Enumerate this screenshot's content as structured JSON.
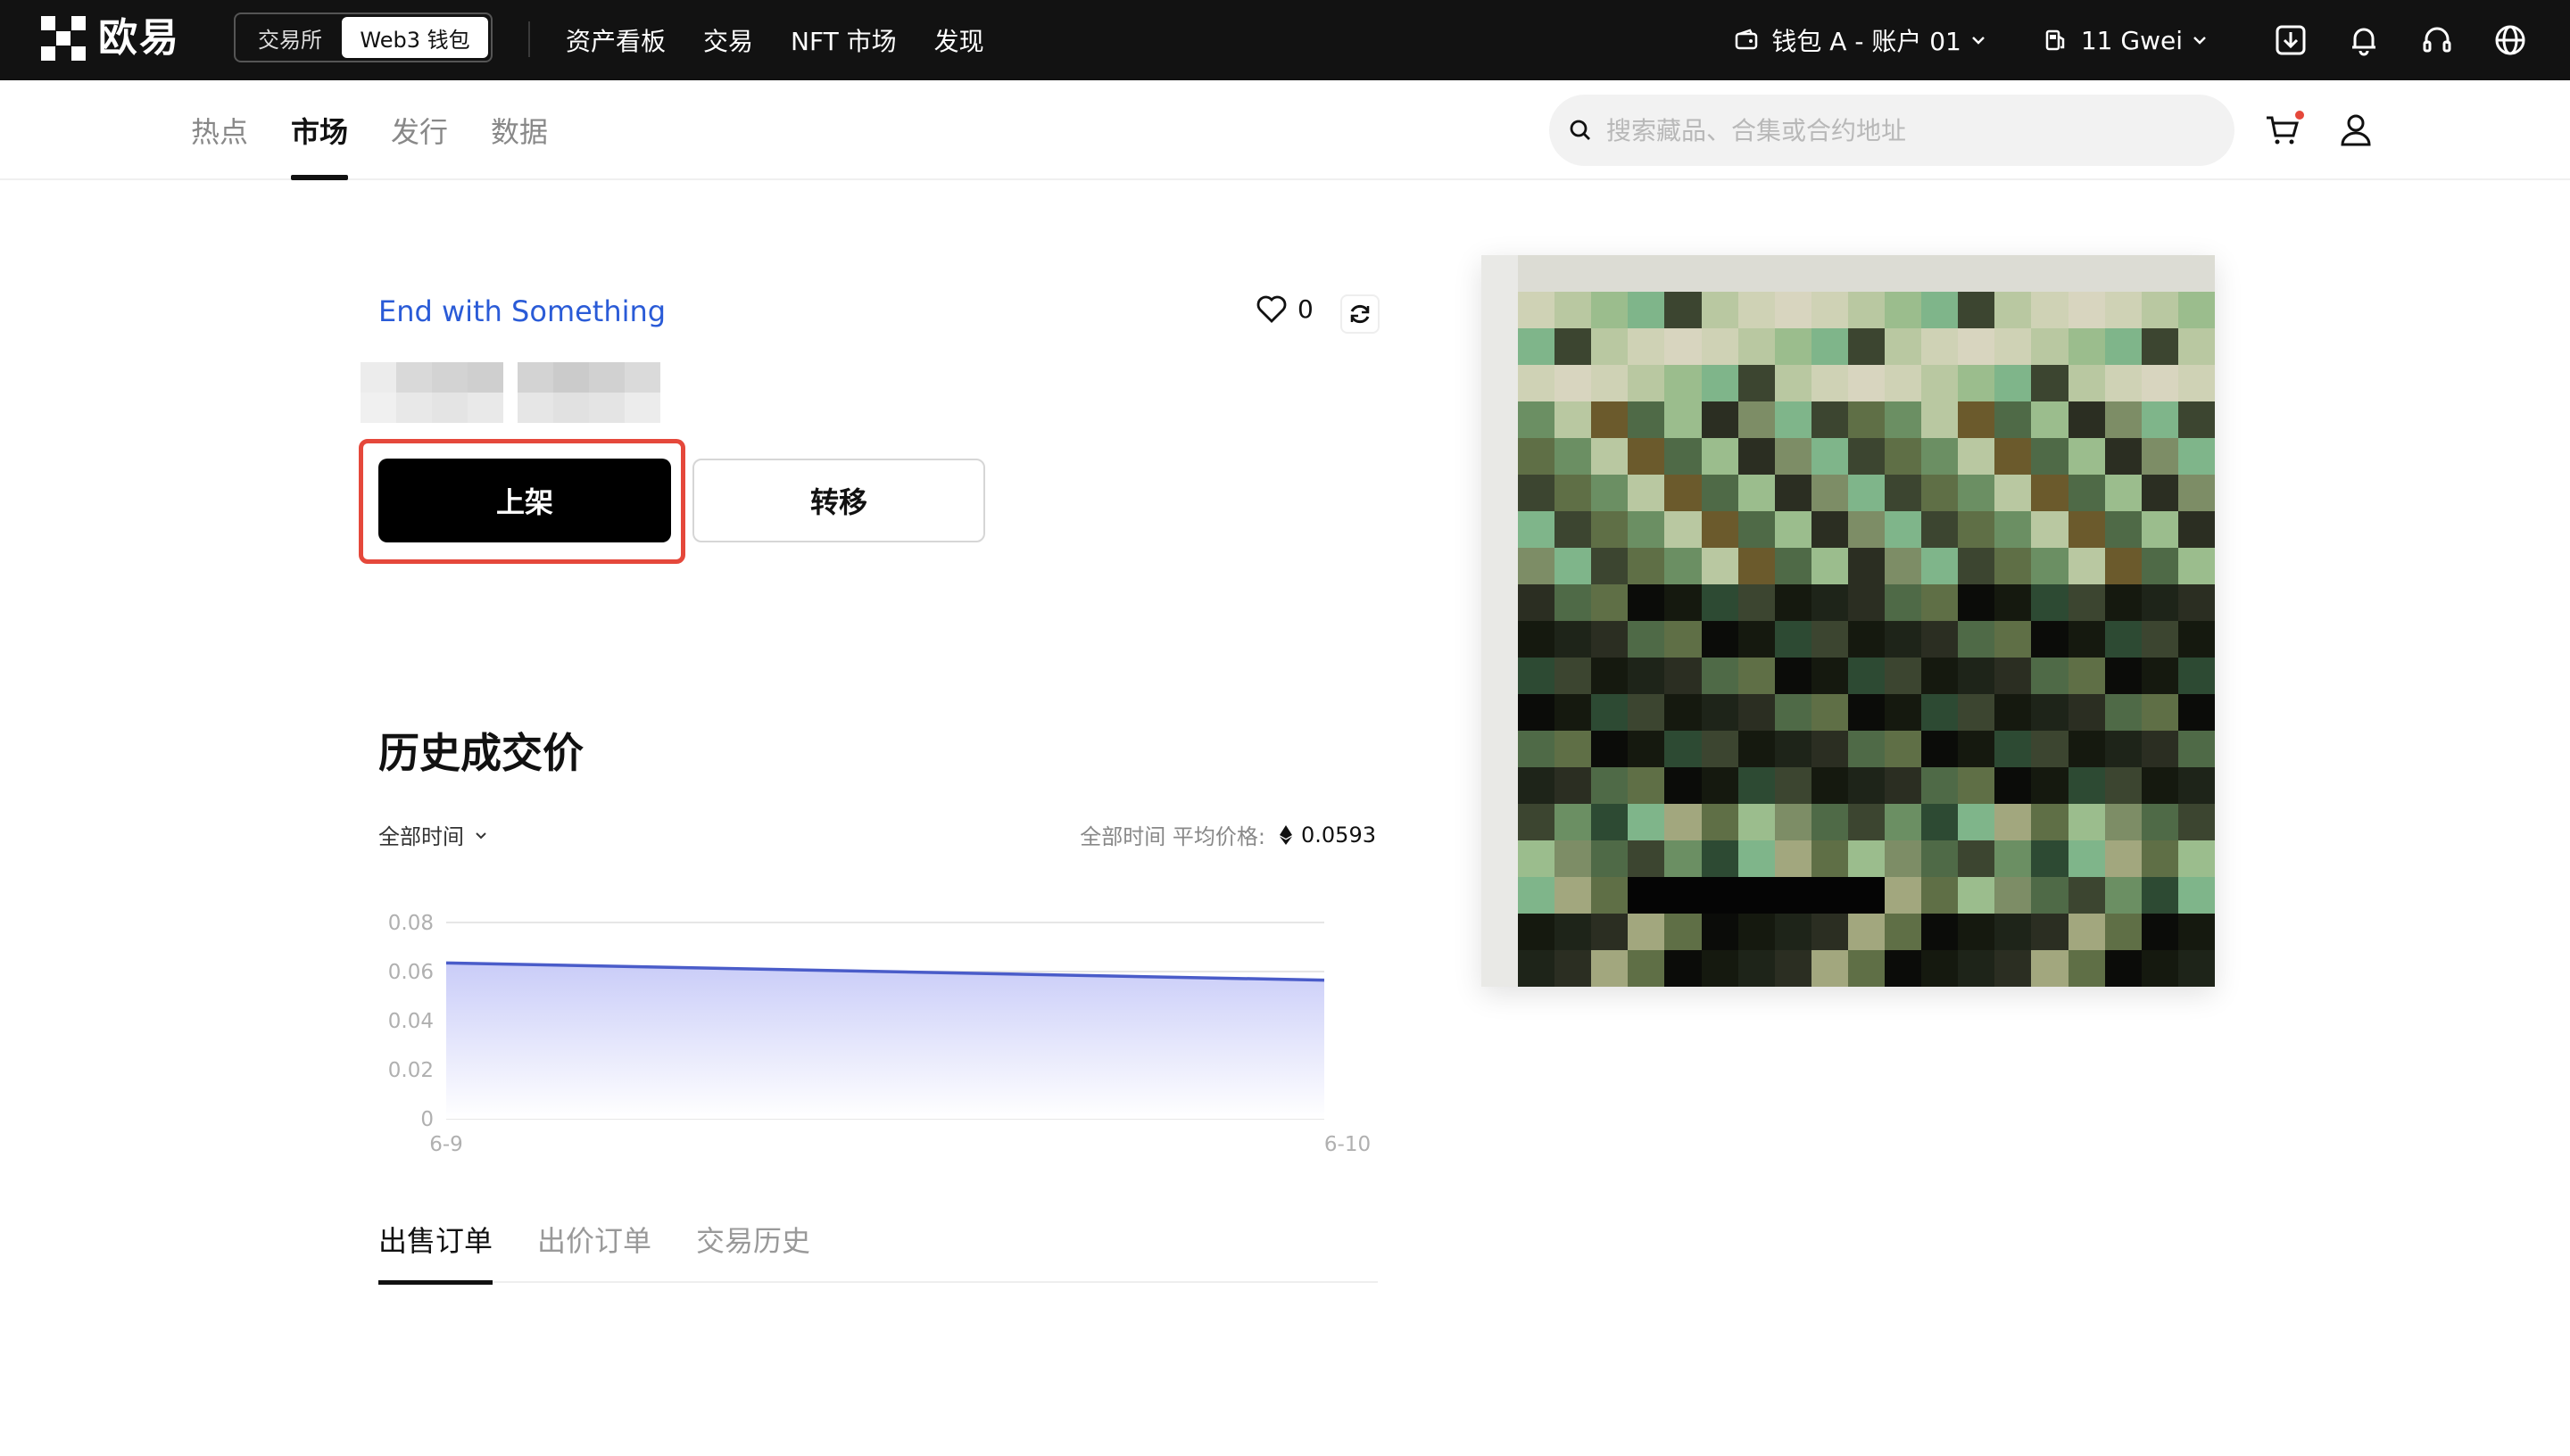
{
  "header": {
    "logo_text": "欧易",
    "mode_switch": {
      "exchange": "交易所",
      "web3": "Web3 钱包"
    },
    "nav": [
      "资产看板",
      "交易",
      "NFT 市场",
      "发现"
    ],
    "wallet_label": "钱包 A - 账户 01",
    "gas_label": "11 Gwei",
    "icons": [
      "download-icon",
      "bell-icon",
      "headset-icon",
      "globe-icon"
    ]
  },
  "subnav": {
    "tabs": [
      {
        "label": "热点",
        "active": false
      },
      {
        "label": "市场",
        "active": true
      },
      {
        "label": "发行",
        "active": false
      },
      {
        "label": "数据",
        "active": false
      }
    ],
    "search_placeholder": "搜索藏品、合集或合约地址"
  },
  "nft": {
    "collection": "End with Something",
    "likes": "0",
    "actions": {
      "list": "上架",
      "transfer": "转移"
    }
  },
  "history": {
    "title": "历史成交价",
    "range": "全部时间",
    "avg_label": "全部时间 平均价格:",
    "avg_value": "0.0593"
  },
  "chart_data": {
    "type": "area",
    "x": [
      "6-9",
      "6-10"
    ],
    "series": [
      {
        "values": [
          0.0635,
          0.0565
        ]
      }
    ],
    "yticks": [
      "0.08",
      "0.06",
      "0.04",
      "0.02",
      "0"
    ],
    "ylim": [
      0,
      0.08
    ],
    "grid": true,
    "color": "#4a5cc9"
  },
  "bottom_tabs": [
    {
      "label": "出售订单",
      "active": true
    },
    {
      "label": "出价订单",
      "active": false
    },
    {
      "label": "交易历史",
      "active": false
    }
  ],
  "colors": {
    "accent_link": "#2a5bd7",
    "highlight": "#e5483b",
    "topbar_bg": "#121212"
  }
}
